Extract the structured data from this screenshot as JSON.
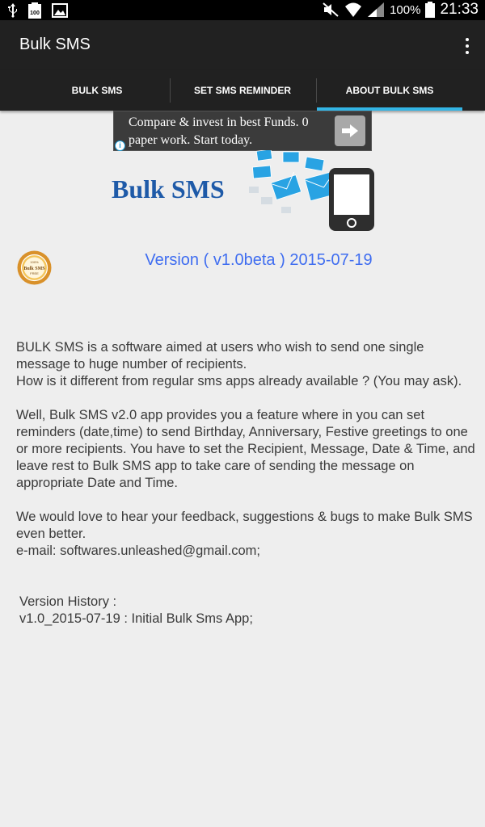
{
  "status_bar": {
    "battery_text": "100%",
    "clock": "21:33"
  },
  "header": {
    "title": "Bulk SMS"
  },
  "tabs": [
    {
      "label": "BULK SMS"
    },
    {
      "label": "SET SMS REMINDER"
    },
    {
      "label": "ABOUT BULK SMS",
      "selected": true
    }
  ],
  "ad": {
    "text": "Compare & invest in best Funds. 0 paper work. Start today.",
    "info_glyph": "i"
  },
  "logo": {
    "text": "Bulk SMS"
  },
  "badge": {
    "line1": "100%",
    "line2": "Bulk SMS",
    "line3": "FREE"
  },
  "version_line": "Version ( v1.0beta ) 2015-07-19",
  "about": {
    "intro_1": " BULK SMS is a software aimed at users who wish to send one single message to huge number of recipients.",
    "intro_2": " How is it different from regular sms apps already available ? (You may ask).",
    "feature": " Well, Bulk SMS v2.0 app provides you a feature where in you can set reminders (date,time) to send Birthday, Anniversary, Festive greetings to one or more recipients. You have to set the Recipient, Message, Date & Time, and leave rest to Bulk SMS app to take care of sending the message on appropriate Date and Time.",
    "feedback": " We would love to hear your feedback, suggestions & bugs to make Bulk SMS even better.",
    "email": " e-mail: softwares.unleashed@gmail.com;",
    "history_title": " Version History :",
    "history_entry": " v1.0_2015-07-19 : Initial Bulk Sms App;"
  },
  "colors": {
    "action_bar": "#212121",
    "tab_indicator": "#33b5e5",
    "version_text": "#3f6df0",
    "logo_text": "#1e5aa8",
    "background": "#eeeeee"
  },
  "icons": [
    "usb-icon",
    "battery-100-notification-icon",
    "image-icon",
    "mute-icon",
    "wifi-icon",
    "signal-icon",
    "battery-icon",
    "overflow-menu-icon",
    "arrow-right-icon",
    "info-icon",
    "envelope-icon",
    "phone-icon",
    "badge-seal-icon"
  ]
}
